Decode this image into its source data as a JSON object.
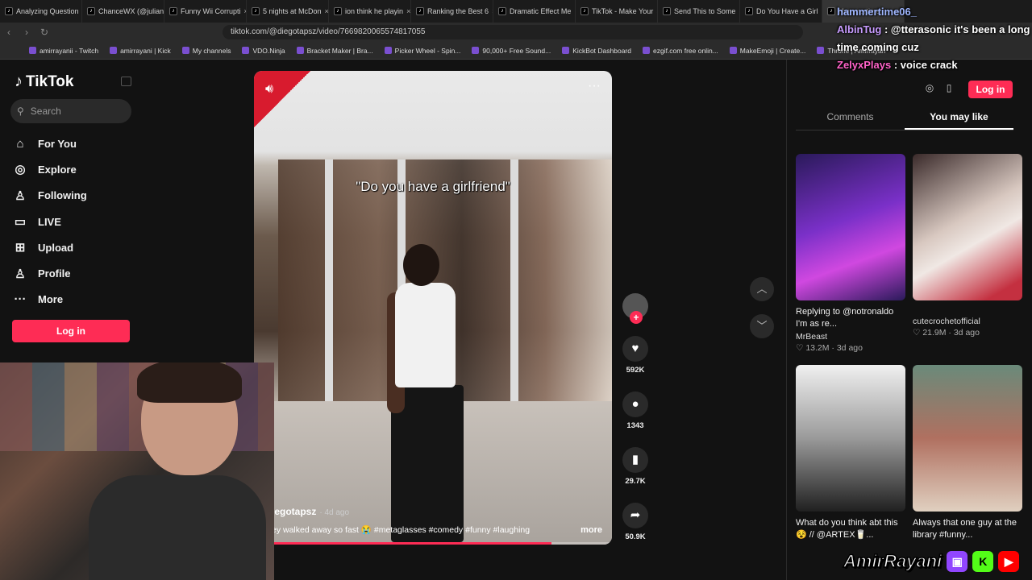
{
  "browser": {
    "tabs": [
      "Analyzing Question",
      "ChanceWX (@julian",
      "Funny Wii Corrupti",
      "5 nights at McDon",
      "ion think he playin",
      "Ranking the Best 6",
      "Dramatic Effect Me",
      "TikTok - Make Your",
      "Send This to Some",
      "Do You Have a Girl",
      "Hammertime"
    ],
    "url": "tiktok.com/@diegotapsz/video/7669820065574817055",
    "bookmarks": [
      "amirrayanii - Twitch",
      "amirrayani | Kick",
      "My channels",
      "VDO.Ninja",
      "Bracket Maker | Bra...",
      "Picker Wheel - Spin...",
      "90,000+ Free Sound...",
      "KickBot Dashboard",
      "ezgif.com free onlin...",
      "MakeEmoji | Create...",
      "Throne | Amirrayan"
    ]
  },
  "tiktok": {
    "logo": "TikTok",
    "search_placeholder": "Search",
    "nav": [
      "For You",
      "Explore",
      "Following",
      "LIVE",
      "Upload",
      "Profile",
      "More"
    ],
    "login": "Log in"
  },
  "video": {
    "quote": "\"Do you have a girlfriend\"",
    "username": "iegotapsz",
    "age": "· 4d ago",
    "description": "ey walked away so fast 😭 #metaglasses #comedy #funny #laughing",
    "more": "more",
    "progress_pct": 83
  },
  "actions": {
    "likes": "592K",
    "comments": "1343",
    "saves": "29.7K",
    "shares": "50.9K"
  },
  "panel": {
    "tabs": [
      "Comments",
      "You may like"
    ],
    "cards": [
      {
        "title": "Replying to @notronaldo I'm as re...",
        "author": "MrBeast",
        "meta": "♡ 13.2M · 3d ago"
      },
      {
        "title": "",
        "author": "cutecrochetofficial",
        "meta": "♡ 21.9M · 3d ago"
      },
      {
        "title": "What do you think abt this😵 // @ARTEX🥛...",
        "author": "",
        "meta": ""
      },
      {
        "title": "Always that one guy at the library #funny...",
        "author": "",
        "meta": ""
      }
    ]
  },
  "chat": [
    {
      "user": "hammertime06_",
      "msg": ""
    },
    {
      "user": "AlbinTug",
      "msg": "@tterasonic it's been a long time coming cuz"
    },
    {
      "user": "ZelyxPlays",
      "msg": "voice crack"
    }
  ],
  "brand": "AmirRayani"
}
